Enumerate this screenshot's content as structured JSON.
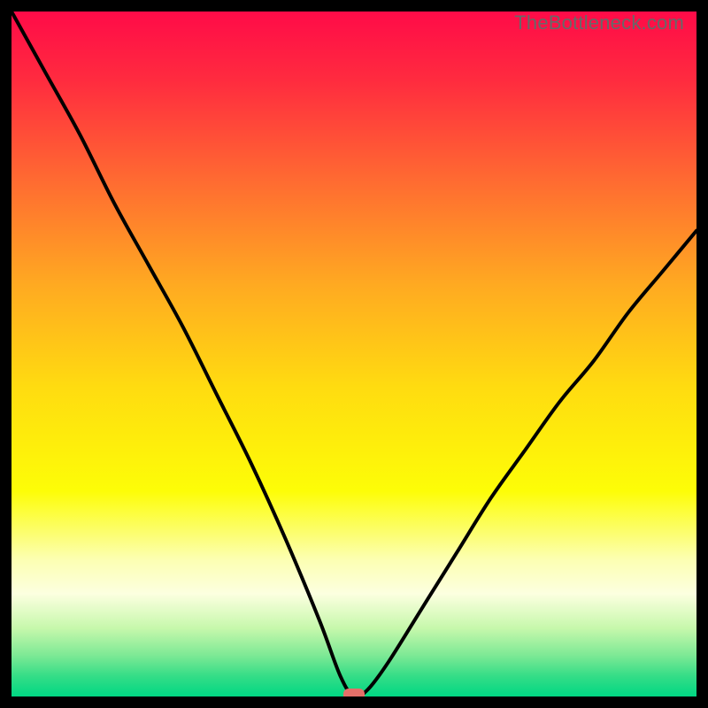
{
  "watermark": "TheBottleneck.com",
  "chart_data": {
    "type": "line",
    "title": "",
    "xlabel": "",
    "ylabel": "",
    "xlim": [
      0,
      100
    ],
    "ylim": [
      0,
      100
    ],
    "x": [
      0,
      5,
      10,
      15,
      20,
      25,
      30,
      35,
      40,
      45,
      48,
      50,
      52,
      55,
      60,
      65,
      70,
      75,
      80,
      85,
      90,
      95,
      100
    ],
    "values": [
      100,
      91,
      82,
      72,
      63,
      54,
      44,
      34,
      23,
      11,
      3,
      0,
      1,
      5,
      13,
      21,
      29,
      36,
      43,
      49,
      56,
      62,
      68
    ],
    "marker": {
      "x": 50,
      "y": 0
    },
    "gradient_stops": [
      {
        "offset": 0.0,
        "color": "#ff0b48"
      },
      {
        "offset": 0.1,
        "color": "#ff2b3f"
      },
      {
        "offset": 0.25,
        "color": "#ff6c31"
      },
      {
        "offset": 0.4,
        "color": "#ffaa21"
      },
      {
        "offset": 0.55,
        "color": "#ffdc10"
      },
      {
        "offset": 0.7,
        "color": "#fdfd07"
      },
      {
        "offset": 0.8,
        "color": "#fcffb2"
      },
      {
        "offset": 0.85,
        "color": "#fcffe0"
      },
      {
        "offset": 0.9,
        "color": "#c7f8ac"
      },
      {
        "offset": 0.94,
        "color": "#7de995"
      },
      {
        "offset": 0.97,
        "color": "#35dd87"
      },
      {
        "offset": 1.0,
        "color": "#00d783"
      }
    ]
  }
}
